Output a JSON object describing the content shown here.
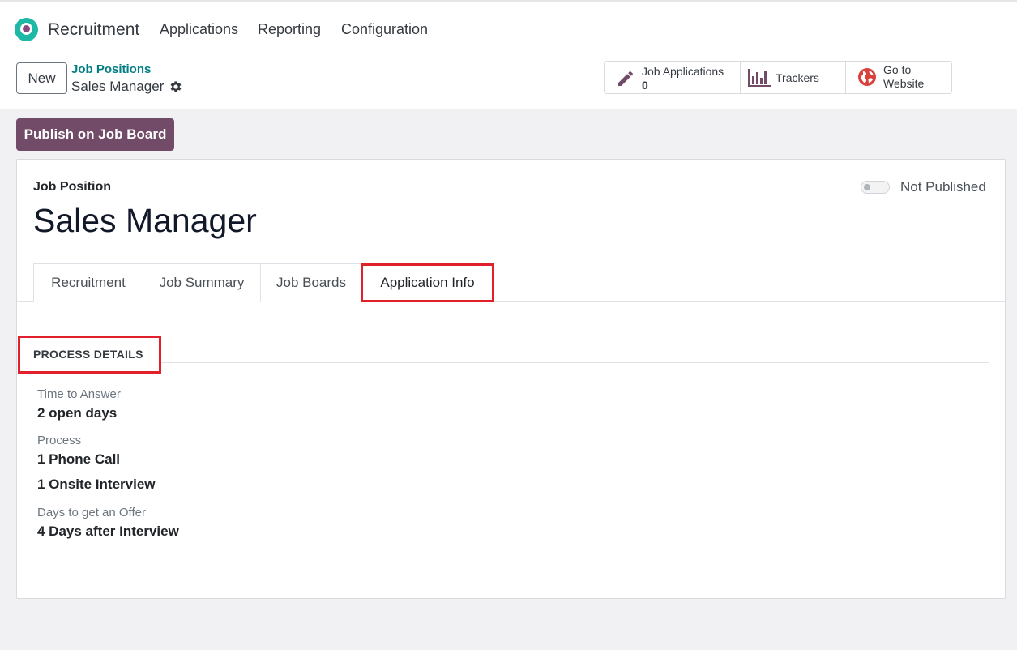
{
  "app": {
    "name": "Recruitment"
  },
  "menu": [
    "Applications",
    "Reporting",
    "Configuration"
  ],
  "control": {
    "new_label": "New",
    "breadcrumb_parent": "Job Positions",
    "breadcrumb_current": "Sales Manager"
  },
  "stats": {
    "applications_label": "Job Applications",
    "applications_value": "0",
    "trackers_label": "Trackers",
    "website_label": "Go to Website"
  },
  "publish_button": "Publish on Job Board",
  "sheet": {
    "title_label": "Job Position",
    "title": "Sales Manager",
    "publish_status": "Not Published"
  },
  "tabs": [
    "Recruitment",
    "Job Summary",
    "Job Boards",
    "Application Info"
  ],
  "section": {
    "title": "PROCESS DETAILS",
    "fields": [
      {
        "label": "Time to Answer",
        "values": [
          "2 open days"
        ]
      },
      {
        "label": "Process",
        "values": [
          "1 Phone Call",
          "1 Onsite Interview"
        ]
      },
      {
        "label": "Days to get an Offer",
        "values": [
          "4 Days after Interview"
        ]
      }
    ]
  },
  "colors": {
    "brand": "#714b67",
    "link": "#017e84",
    "highlight": "#e0202a",
    "logo": "#1fb7a6"
  }
}
